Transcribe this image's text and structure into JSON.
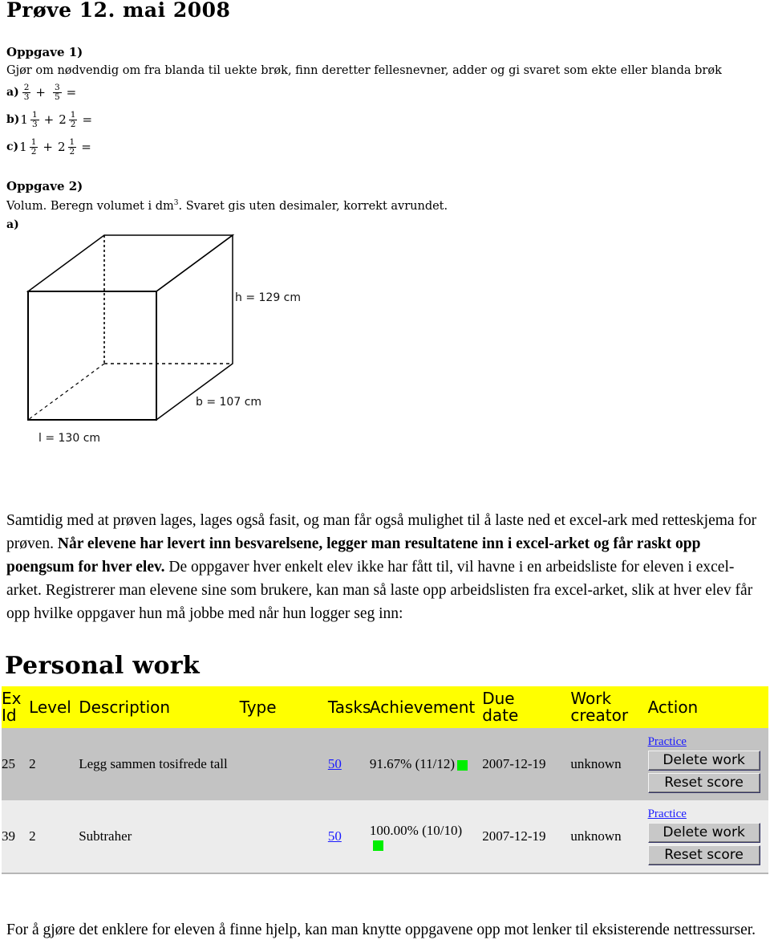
{
  "exam": {
    "title": "Prøve 12. mai 2008",
    "task1": {
      "heading": "Oppgave 1)",
      "intro": "Gjør om nødvendig om fra blanda til uekte brøk, finn deretter fellesnevner, adder og gi svaret som ekte eller blanda brøk",
      "equations": [
        {
          "label": "a)",
          "whole1": "",
          "num1": "2",
          "den1": "3",
          "op": "+",
          "whole2": "",
          "num2": "3",
          "den2": "5",
          "equals": "="
        },
        {
          "label": "b)",
          "whole1": "1",
          "num1": "1",
          "den1": "3",
          "op": "+",
          "whole2": "2",
          "num2": "1",
          "den2": "2",
          "equals": "="
        },
        {
          "label": "c)",
          "whole1": "1",
          "num1": "1",
          "den1": "2",
          "op": "+",
          "whole2": "2",
          "num2": "1",
          "den2": "2",
          "equals": "="
        }
      ]
    },
    "task2": {
      "heading": "Oppgave 2)",
      "intro_pre": "Volum. Beregn volumet i dm",
      "intro_sup": "3",
      "intro_post": ". Svaret gis uten desimaler, korrekt avrundet.",
      "figure": {
        "height_label": "h = 129 cm",
        "depth_label": "b = 107 cm",
        "length_label": "l = 130 cm",
        "sub_letter": "a)"
      }
    }
  },
  "prose": {
    "main_1": "Samtidig med at prøven lages, lages også fasit, og man får også mulighet til å laste ned et excel-ark med retteskjema for prøven. ",
    "main_2": "Når elevene har levert inn besvarelsene, legger man resultatene inn i excel-arket og får raskt opp poengsum for hver elev.",
    "main_3": " De oppgaver hver enkelt elev ikke har fått til, vil havne i en arbeidsliste for eleven i excel-arket. Registrerer man elevene sine som brukere, kan man så laste opp arbeidslisten fra excel-arket, slik at hver elev får opp hvilke oppgaver hun må jobbe med når hun logger seg inn:",
    "bottom": "For å gjøre det enklere for eleven å finne hjelp, kan man knytte oppgavene opp mot lenker til eksisterende nettressurser."
  },
  "personal_work": {
    "heading": "Personal work",
    "columns": [
      {
        "key": "ex_id",
        "label_line1": "Ex",
        "label_line2": "Id"
      },
      {
        "key": "level",
        "label_line1": "Level",
        "label_line2": ""
      },
      {
        "key": "description",
        "label_line1": "Description",
        "label_line2": ""
      },
      {
        "key": "type",
        "label_line1": "Type",
        "label_line2": ""
      },
      {
        "key": "tasks",
        "label_line1": "Tasks",
        "label_line2": ""
      },
      {
        "key": "achievement",
        "label_line1": "Achievement",
        "label_line2": ""
      },
      {
        "key": "due_date",
        "label_line1": "Due",
        "label_line2": "date"
      },
      {
        "key": "work_creator",
        "label_line1": "Work",
        "label_line2": "creator"
      },
      {
        "key": "action",
        "label_line1": "Action",
        "label_line2": ""
      }
    ],
    "header_bg": "#ffff00",
    "rows": [
      {
        "ex_id": "25",
        "level": "2",
        "description": "Legg sammen tosifrede tall",
        "type": "",
        "tasks": "50",
        "achievement": "91.67% (11/12)",
        "status_color": "#00ee00",
        "due_date": "2007-12-19",
        "work_creator": "unknown",
        "practice_label": "Practice",
        "delete_label": "Delete work",
        "reset_label": "Reset score"
      },
      {
        "ex_id": "39",
        "level": "2",
        "description": "Subtraher",
        "type": "",
        "tasks": "50",
        "achievement": "100.00% (10/10)",
        "status_color": "#00ee00",
        "due_date": "2007-12-19",
        "work_creator": "unknown",
        "practice_label": "Practice",
        "delete_label": "Delete work",
        "reset_label": "Reset score"
      }
    ]
  }
}
